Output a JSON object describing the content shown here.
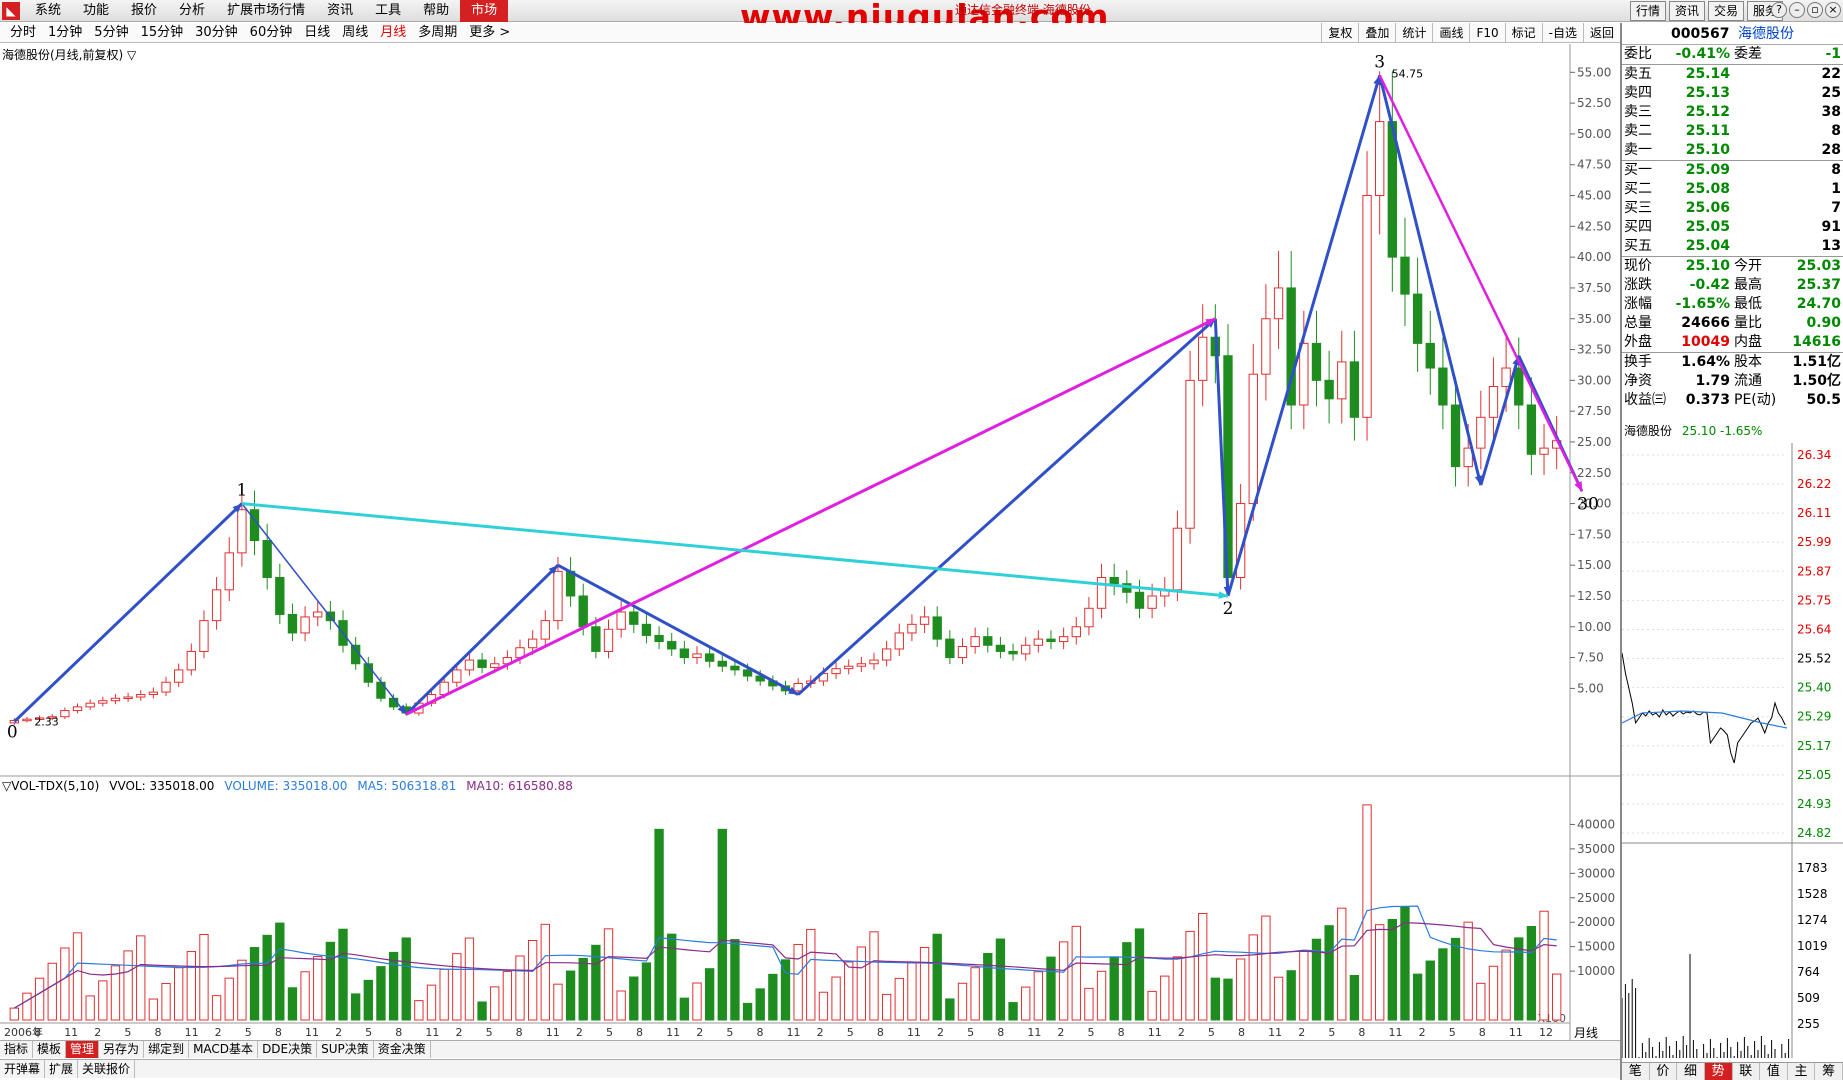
{
  "topbar": {
    "menu": [
      "系统",
      "功能",
      "报价",
      "分析",
      "扩展市场行情",
      "资讯",
      "工具",
      "帮助",
      "市场"
    ],
    "watermark": "www.niugulan.com",
    "subtitle": "通达信金融终端 海德股份",
    "right_buttons": [
      "行情",
      "资讯",
      "交易",
      "服务"
    ]
  },
  "periods": [
    "分时",
    "1分钟",
    "5分钟",
    "15分钟",
    "30分钟",
    "60分钟",
    "日线",
    "周线",
    "月线",
    "多周期",
    "更多 >"
  ],
  "active_period": "月线",
  "chart_tools": [
    "复权",
    "叠加",
    "统计",
    "画线",
    "F10",
    "标记",
    "-自选",
    "返回"
  ],
  "chart_title": "海德股份(月线,前复权) ▽",
  "chart_data": {
    "type": "candlestick",
    "price_axis": [
      55.0,
      52.5,
      50.0,
      47.5,
      45.0,
      42.5,
      40.0,
      37.5,
      35.0,
      32.5,
      30.0,
      27.5,
      25.0,
      22.5,
      20.0,
      17.5,
      15.0,
      12.5,
      10.0,
      7.5,
      5.0
    ],
    "ylim": [
      0,
      56
    ],
    "annotations": [
      {
        "label": "0",
        "price": 2.33
      },
      {
        "label": "1",
        "price": 20.0
      },
      {
        "label": "2",
        "price": 12.5
      },
      {
        "label": "3",
        "price": 54.75
      },
      {
        "label": "30",
        "price": 21.0
      }
    ],
    "price_labels": [
      "2.33",
      "54.75"
    ],
    "closes": [
      2.4,
      2.5,
      2.6,
      2.7,
      3.2,
      3.5,
      3.8,
      4.0,
      4.2,
      4.3,
      4.5,
      4.7,
      5.5,
      6.5,
      8.0,
      10.5,
      13.0,
      16.0,
      19.5,
      17.0,
      14.0,
      11.0,
      9.5,
      10.8,
      11.2,
      10.5,
      8.5,
      7.0,
      5.5,
      4.2,
      3.5,
      3.0,
      3.8,
      4.5,
      5.5,
      6.5,
      7.3,
      6.7,
      7.0,
      7.5,
      8.3,
      9.0,
      10.5,
      14.5,
      12.5,
      10.0,
      8.0,
      9.8,
      11.2,
      10.2,
      9.3,
      8.8,
      8.2,
      7.5,
      7.8,
      7.2,
      6.8,
      6.5,
      6.0,
      5.6,
      5.2,
      4.8,
      5.4,
      5.6,
      6.2,
      6.6,
      6.8,
      7.0,
      7.3,
      8.2,
      9.5,
      10.2,
      10.8,
      9.0,
      7.5,
      8.4,
      9.2,
      8.5,
      8.0,
      7.8,
      8.5,
      9.0,
      8.8,
      9.2,
      10.0,
      11.5,
      14.0,
      13.5,
      12.8,
      11.5,
      12.5,
      13.0,
      18.0,
      30.0,
      33.5,
      32.0,
      14.0,
      20.0,
      30.5,
      35.0,
      37.5,
      28.0,
      33.0,
      30.0,
      28.5,
      31.5,
      27.0,
      45.0,
      51.0,
      40.0,
      37.0,
      33.0,
      31.0,
      28.0,
      23.0,
      24.5,
      27.0,
      29.5,
      31.0,
      28.0,
      24.0,
      24.5,
      25.1
    ],
    "x_axis_labels": [
      "2006年",
      "8",
      "11",
      "2",
      "5",
      "8",
      "11",
      "2",
      "5",
      "8",
      "11",
      "2",
      "5",
      "8",
      "11",
      "2",
      "5",
      "8",
      "11",
      "2",
      "5",
      "8",
      "11",
      "2",
      "5",
      "8",
      "11",
      "2",
      "5",
      "8",
      "11",
      "2",
      "5",
      "8",
      "11",
      "2",
      "5",
      "8",
      "11",
      "2",
      "5",
      "8",
      "11",
      "2",
      "5",
      "8",
      "11",
      "2",
      "5",
      "8",
      "11",
      "12"
    ],
    "volume_axis": [
      "40000",
      "35000",
      "30000",
      "25000",
      "20000",
      "15000",
      "10000"
    ],
    "volume_scale": "X100"
  },
  "volume_legend": {
    "indicator": "▽VOL-TDX(5,10)",
    "vvol": "VVOL: 335018.00",
    "volume": "VOLUME: 335018.00",
    "ma5": "MA5: 506318.81",
    "ma10": "MA10: 616580.88"
  },
  "bottom_tabs": [
    "指标",
    "模板",
    "管理",
    "另存为",
    "绑定到",
    "MACD基本",
    "DDE决策",
    "SUP决策",
    "资金决策"
  ],
  "bottom_active": "管理",
  "bottom_tabs2": [
    "开弹幕",
    "扩展",
    "关联报价"
  ],
  "month_label": "月线",
  "quote": {
    "code": "000567",
    "name": "海德股份",
    "weibi_label": "委比",
    "weibi": "-0.41%",
    "weicha_label": "委差",
    "weicha": "-1",
    "sells": [
      {
        "label": "卖五",
        "price": "25.14",
        "vol": "22"
      },
      {
        "label": "卖四",
        "price": "25.13",
        "vol": "25"
      },
      {
        "label": "卖三",
        "price": "25.12",
        "vol": "38"
      },
      {
        "label": "卖二",
        "price": "25.11",
        "vol": "8"
      },
      {
        "label": "卖一",
        "price": "25.10",
        "vol": "28"
      }
    ],
    "buys": [
      {
        "label": "买一",
        "price": "25.09",
        "vol": "8"
      },
      {
        "label": "买二",
        "price": "25.08",
        "vol": "1"
      },
      {
        "label": "买三",
        "price": "25.06",
        "vol": "7"
      },
      {
        "label": "买四",
        "price": "25.05",
        "vol": "91"
      },
      {
        "label": "买五",
        "price": "25.04",
        "vol": "13"
      }
    ],
    "stats": [
      {
        "k1": "现价",
        "v1": "25.10",
        "c1": "g",
        "k2": "今开",
        "v2": "25.03",
        "c2": "g"
      },
      {
        "k1": "涨跌",
        "v1": "-0.42",
        "c1": "g",
        "k2": "最高",
        "v2": "25.37",
        "c2": "g"
      },
      {
        "k1": "涨幅",
        "v1": "-1.65%",
        "c1": "g",
        "k2": "最低",
        "v2": "24.70",
        "c2": "g"
      },
      {
        "k1": "总量",
        "v1": "24666",
        "c1": "",
        "k2": "量比",
        "v2": "0.90",
        "c2": "g"
      },
      {
        "k1": "外盘",
        "v1": "10049",
        "c1": "r",
        "k2": "内盘",
        "v2": "14616",
        "c2": "g"
      }
    ],
    "stats2": [
      {
        "k1": "换手",
        "v1": "1.64%",
        "k2": "股本",
        "v2": "1.51亿"
      },
      {
        "k1": "净资",
        "v1": "1.79",
        "k2": "流通",
        "v2": "1.50亿"
      },
      {
        "k1": "收益㈢",
        "v1": "0.373",
        "k2": "PE(动)",
        "v2": "50.5"
      }
    ],
    "mini_title": "海德股份",
    "mini_price": "25.10 -1.65%",
    "mini_price_axis": [
      "26.34",
      "26.22",
      "26.11",
      "25.99",
      "25.87",
      "25.75",
      "25.64",
      "25.52",
      "25.40",
      "25.29",
      "25.17",
      "25.05",
      "24.93",
      "24.82"
    ],
    "mini_vol_axis": [
      "1783",
      "1528",
      "1274",
      "1019",
      "764",
      "509",
      "255"
    ],
    "panel_tabs": [
      "笔",
      "价",
      "细",
      "势",
      "联",
      "值",
      "主",
      "筹"
    ],
    "panel_active": "势"
  },
  "colors": {
    "up": "#e03030",
    "down": "#1e8c1e",
    "blue": "#3050c8",
    "magenta": "#e020e0",
    "cyan": "#30d0d8",
    "ma5": "#2a7ce0",
    "ma10": "#8a2a8a"
  }
}
